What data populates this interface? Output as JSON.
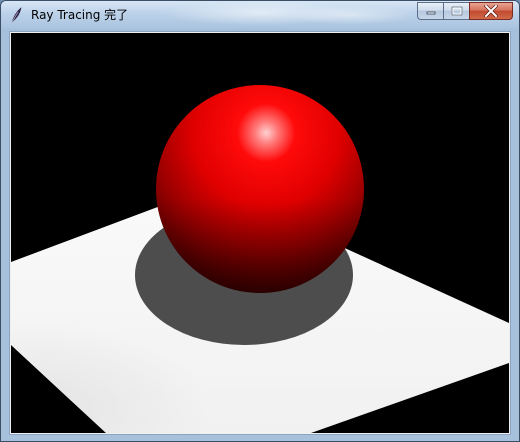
{
  "window": {
    "title": "Ray Tracing 完了",
    "controls": {
      "minimize": "minimize-icon",
      "maximize": "maximize-icon",
      "close": "close-icon"
    }
  },
  "scene": {
    "background_color": "#000000",
    "floor_color": "#ffffff",
    "sphere_color": "#ff0000",
    "shadow_color": "#4d4d4d"
  }
}
